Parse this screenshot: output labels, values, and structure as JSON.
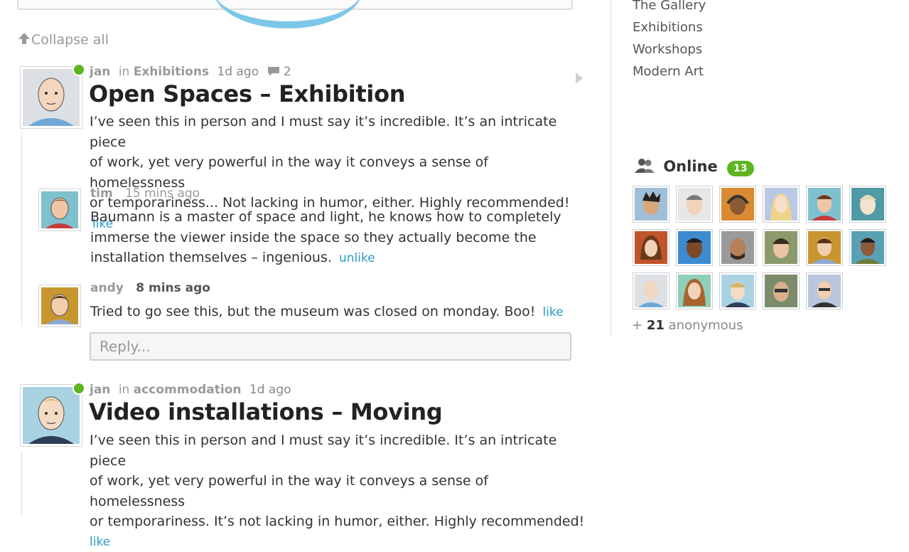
{
  "top": {
    "collapse_label": "Collapse all"
  },
  "posts": [
    {
      "author": "jan",
      "in_label": "in",
      "category": "Exhibitions",
      "time": "1d ago",
      "comment_count": "2",
      "title": "Open Spaces – Exhibition",
      "body_lines": [
        "I’ve seen this in person and I must say it’s incredible. It’s an intricate piece",
        "of work, yet very powerful in the way it conveys a sense of homelessness",
        "or temporariness... Not lacking in humor, either. Highly recommended!"
      ],
      "like_label": "like",
      "comments": [
        {
          "author": "tim",
          "time": "15 mins ago",
          "lines": [
            "Baumann is a master of space and light, he knows how to completely",
            "immerse the viewer inside the space so they actually become the",
            "installation themselves – ingenious."
          ],
          "action": "unlike"
        },
        {
          "author": "andy",
          "time": "8 mins ago",
          "lines": [
            "Tried to go see this, but the museum was closed on monday. Boo!"
          ],
          "action": "like"
        }
      ],
      "reply_placeholder": "Reply..."
    },
    {
      "author": "jan",
      "in_label": "in",
      "category": "accommodation",
      "time": "1d ago",
      "title": "Video installations – Moving",
      "body_lines": [
        "I’ve seen this in person and I must say it’s incredible. It’s an intricate piece",
        "of work, yet very powerful in the way it conveys a sense of homelessness",
        "or temporariness. It’s not lacking in humor, either. Highly recommended!"
      ],
      "like_label": "like"
    }
  ],
  "sidebar": {
    "links": [
      "The Gallery",
      "Exhibitions",
      "Workshops",
      "Modern Art"
    ],
    "online_label": "Online",
    "online_count": "13",
    "anonymous_prefix": "+",
    "anonymous_count": "21",
    "anonymous_label": "anonymous"
  },
  "colors": {
    "accent_link": "#2b9cc4",
    "online_green": "#5eb51e",
    "title_text": "#222222",
    "muted_text": "#9a9a9a"
  },
  "icons": {
    "collapse": "arrow-up-icon",
    "comment": "speech-bubble-icon",
    "expand": "triangle-right-icon",
    "online": "users-icon"
  }
}
